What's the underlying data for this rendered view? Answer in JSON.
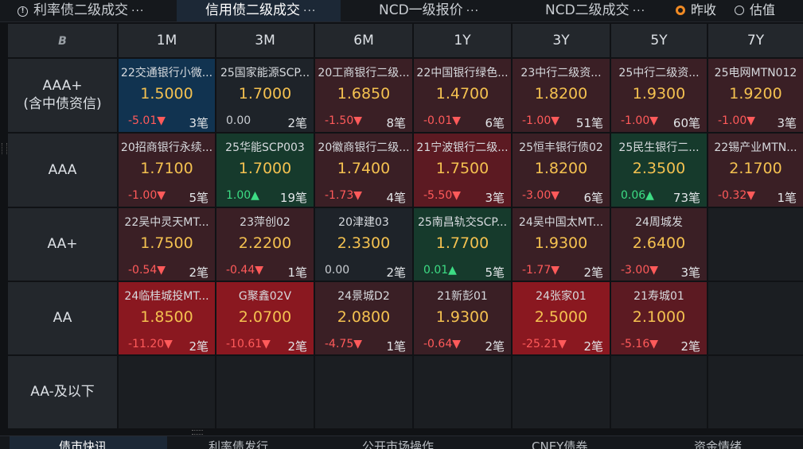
{
  "top_tabs": [
    {
      "label": "利率债二级成交",
      "more": "···"
    },
    {
      "label": "信用债二级成交",
      "more": "···"
    },
    {
      "label": "NCD一级报价",
      "more": "···"
    },
    {
      "label": "NCD二级成交",
      "more": "···"
    }
  ],
  "radios": [
    {
      "label": "昨收",
      "selected": true
    },
    {
      "label": "估值",
      "selected": false
    }
  ],
  "columns": [
    "1M",
    "3M",
    "6M",
    "1Y",
    "3Y",
    "5Y",
    "7Y"
  ],
  "rows": [
    {
      "label": "AAA+",
      "sub": "(含中债资信)",
      "cells": [
        {
          "name": "22交通银行小微...",
          "yield": "1.5000",
          "change": "-5.01▼",
          "count": "3笔",
          "dir": "down",
          "bg": "#113350"
        },
        {
          "name": "25国家能源SCP...",
          "yield": "1.7000",
          "change": "0.00",
          "count": "2笔",
          "dir": "flat",
          "bg": "#1e2329"
        },
        {
          "name": "20工商银行二级...",
          "yield": "1.6850",
          "change": "-1.50▼",
          "count": "8笔",
          "dir": "down",
          "bg": "#3a1f25"
        },
        {
          "name": "22中国银行绿色...",
          "yield": "1.4700",
          "change": "-0.01▼",
          "count": "6笔",
          "dir": "down",
          "bg": "#3a1f25"
        },
        {
          "name": "23中行二级资...",
          "yield": "1.8200",
          "change": "-1.00▼",
          "count": "51笔",
          "dir": "down",
          "bg": "#3a1f25"
        },
        {
          "name": "25中行二级资...",
          "yield": "1.9300",
          "change": "-1.00▼",
          "count": "60笔",
          "dir": "down",
          "bg": "#3a1f25"
        },
        {
          "name": "25电网MTN012",
          "yield": "1.9200",
          "change": "-1.00▼",
          "count": "3笔",
          "dir": "down",
          "bg": "#3a1f25"
        }
      ]
    },
    {
      "label": "AAA",
      "sub": "",
      "cells": [
        {
          "name": "20招商银行永续...",
          "yield": "1.7100",
          "change": "-1.00▼",
          "count": "5笔",
          "dir": "down",
          "bg": "#3a1f25"
        },
        {
          "name": "25华能SCP003",
          "yield": "1.7000",
          "change": "1.00▲",
          "count": "19笔",
          "dir": "up",
          "bg": "#163a2c"
        },
        {
          "name": "20徽商银行二级...",
          "yield": "1.7400",
          "change": "-1.73▼",
          "count": "4笔",
          "dir": "down",
          "bg": "#3a1f25"
        },
        {
          "name": "21宁波银行二级...",
          "yield": "1.7500",
          "change": "-5.50▼",
          "count": "3笔",
          "dir": "down",
          "bg": "#5c1a22"
        },
        {
          "name": "25恒丰银行债02",
          "yield": "1.8200",
          "change": "-3.00▼",
          "count": "6笔",
          "dir": "down",
          "bg": "#3a1f25"
        },
        {
          "name": "25民生银行二...",
          "yield": "2.3500",
          "change": "0.06▲",
          "count": "73笔",
          "dir": "up",
          "bg": "#163a2c"
        },
        {
          "name": "22锡产业MTN...",
          "yield": "2.1700",
          "change": "-0.32▼",
          "count": "1笔",
          "dir": "down",
          "bg": "#3a1f25"
        }
      ]
    },
    {
      "label": "AA+",
      "sub": "",
      "cells": [
        {
          "name": "22吴中灵天MT...",
          "yield": "1.7500",
          "change": "-0.54▼",
          "count": "2笔",
          "dir": "down",
          "bg": "#3a1f25"
        },
        {
          "name": "23萍创02",
          "yield": "2.2200",
          "change": "-0.44▼",
          "count": "1笔",
          "dir": "down",
          "bg": "#3a1f25"
        },
        {
          "name": "20津建03",
          "yield": "2.3300",
          "change": "0.00",
          "count": "2笔",
          "dir": "flat",
          "bg": "#1e2329"
        },
        {
          "name": "25南昌轨交SCP...",
          "yield": "1.7700",
          "change": "0.01▲",
          "count": "5笔",
          "dir": "up",
          "bg": "#163a2c"
        },
        {
          "name": "24吴中国太MT...",
          "yield": "1.9300",
          "change": "-1.77▼",
          "count": "2笔",
          "dir": "down",
          "bg": "#3a1f25"
        },
        {
          "name": "24周城发",
          "yield": "2.6400",
          "change": "-3.00▼",
          "count": "3笔",
          "dir": "down",
          "bg": "#3a1f25"
        },
        null
      ]
    },
    {
      "label": "AA",
      "sub": "",
      "cells": [
        {
          "name": "24临桂城投MT...",
          "yield": "1.8500",
          "change": "-11.20▼",
          "count": "2笔",
          "dir": "down",
          "bg": "#8a1820"
        },
        {
          "name": "G聚鑫02V",
          "yield": "2.0700",
          "change": "-10.61▼",
          "count": "2笔",
          "dir": "down",
          "bg": "#8a1820"
        },
        {
          "name": "24景城D2",
          "yield": "2.0800",
          "change": "-4.75▼",
          "count": "1笔",
          "dir": "down",
          "bg": "#3a1f25"
        },
        {
          "name": "21新彭01",
          "yield": "1.9300",
          "change": "-0.64▼",
          "count": "2笔",
          "dir": "down",
          "bg": "#3a1f25"
        },
        {
          "name": "24张家01",
          "yield": "2.5000",
          "change": "-25.21▼",
          "count": "2笔",
          "dir": "down",
          "bg": "#8a1820"
        },
        {
          "name": "21寿城01",
          "yield": "2.1000",
          "change": "-5.16▼",
          "count": "2笔",
          "dir": "down",
          "bg": "#5c1a22"
        },
        null
      ]
    },
    {
      "label": "AA-及以下",
      "sub": "",
      "cells": [
        null,
        null,
        null,
        null,
        null,
        null,
        null
      ]
    }
  ],
  "bottom_tabs": [
    "债市快讯",
    "利率债发行",
    "公开市场操作",
    "CNEY债券",
    "资金情绪"
  ],
  "colors": {
    "yield": "#f4c150",
    "down": "#ff5a5a",
    "up": "#3ddc84",
    "accent": "#f08a24"
  },
  "icons": {
    "corner": "logo-icon",
    "tab_info": "info-icon"
  }
}
